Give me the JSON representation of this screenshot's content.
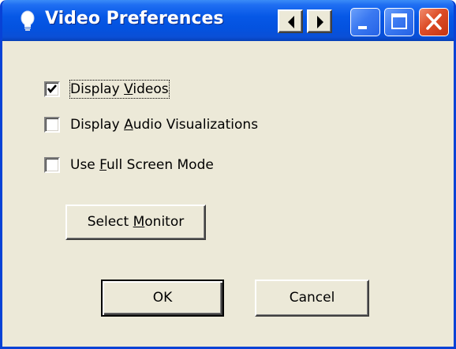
{
  "window": {
    "title": "Video Preferences",
    "icon": "lightbulb-icon",
    "nav_prev_icon": "arrow-left-icon",
    "nav_next_icon": "arrow-right-icon",
    "caption_buttons": [
      "minimize-icon",
      "maximize-icon",
      "close-icon"
    ],
    "titlebar_color": "#0658e6",
    "close_color": "#dd4d27"
  },
  "options": {
    "display_videos": {
      "label_before": "Display ",
      "mnemonic": "V",
      "label_after": "ideos",
      "checked": true
    },
    "display_audio_visualizations": {
      "label_before": "Display ",
      "mnemonic": "A",
      "label_after": "udio Visualizations",
      "checked": false
    },
    "use_full_screen_mode": {
      "label_before": "Use ",
      "mnemonic": "F",
      "label_after": "ull Screen Mode",
      "checked": false
    }
  },
  "buttons": {
    "select_monitor": {
      "label_before": "Select ",
      "mnemonic": "M",
      "label_after": "onitor"
    },
    "ok": {
      "label": "OK"
    },
    "cancel": {
      "label": "Cancel"
    }
  }
}
